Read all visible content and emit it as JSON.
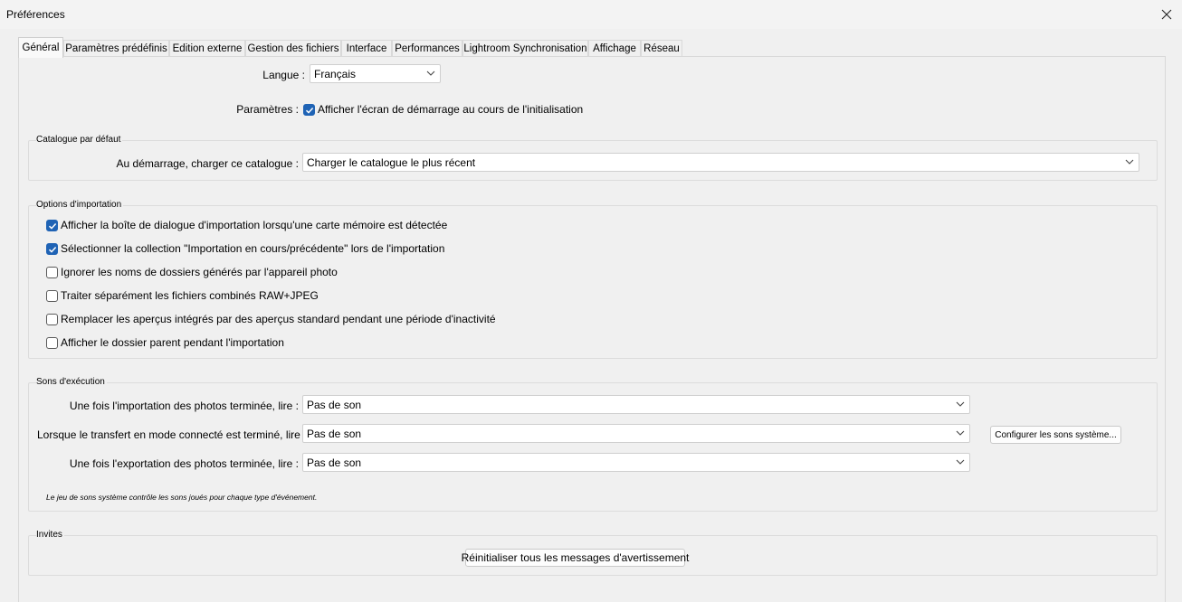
{
  "window": {
    "title": "Préférences",
    "close_icon": "close-icon"
  },
  "tabs": [
    {
      "label": "Général",
      "active": true
    },
    {
      "label": "Paramètres prédéfinis"
    },
    {
      "label": "Edition externe"
    },
    {
      "label": "Gestion des fichiers"
    },
    {
      "label": "Interface"
    },
    {
      "label": "Performances"
    },
    {
      "label": "Lightroom Synchronisation"
    },
    {
      "label": "Affichage"
    },
    {
      "label": "Réseau"
    }
  ],
  "general": {
    "language_label": "Langue :",
    "language_value": "Français",
    "settings_label": "Paramètres :",
    "splash_checkbox": {
      "label": "Afficher l'écran de démarrage au cours de l'initialisation",
      "checked": true
    }
  },
  "catalog": {
    "legend": "Catalogue par défaut",
    "startup_label": "Au démarrage, charger ce catalogue :",
    "startup_value": "Charger le catalogue le plus récent"
  },
  "import_options": {
    "legend": "Options d'importation",
    "checkboxes": [
      {
        "label": "Afficher la boîte de dialogue d'importation lorsqu'une carte mémoire est détectée",
        "checked": true
      },
      {
        "label": "Sélectionner la collection \"Importation en cours/précédente\" lors de l'importation",
        "checked": true
      },
      {
        "label": "Ignorer les noms de dossiers générés par l'appareil photo",
        "checked": false
      },
      {
        "label": "Traiter séparément les fichiers combinés RAW+JPEG",
        "checked": false
      },
      {
        "label": "Remplacer les aperçus intégrés par des aperçus standard pendant une période d'inactivité",
        "checked": false
      },
      {
        "label": "Afficher le dossier parent pendant l'importation",
        "checked": false
      }
    ]
  },
  "sounds": {
    "legend": "Sons d'exécution",
    "rows": [
      {
        "label": "Une fois l'importation des photos terminée, lire :",
        "value": "Pas de son"
      },
      {
        "label": "Lorsque le transfert en mode connecté est terminé, lire :",
        "value": "Pas de son"
      },
      {
        "label": "Une fois l'exportation des photos terminée, lire :",
        "value": "Pas de son"
      }
    ],
    "configure_button": "Configurer les sons système...",
    "note": "Le jeu de sons système contrôle les sons joués pour chaque type d'événement."
  },
  "prompts": {
    "legend": "Invites",
    "reset_button": "Réinitialiser tous les messages d'avertissement"
  },
  "colors": {
    "accent": "#1f63b5",
    "background": "#f0f0f0"
  }
}
